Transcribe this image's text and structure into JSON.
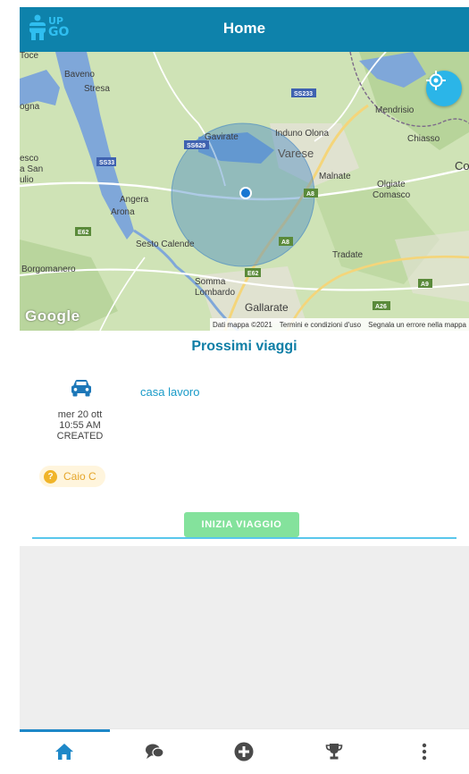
{
  "header": {
    "title": "Home",
    "logo_text_top": "UP",
    "logo_text_bottom": "GO"
  },
  "map": {
    "place_labels": [
      "Baveno",
      "Stresa",
      "Gavirate",
      "Induno Olona",
      "Mendrisio",
      "Chiasso",
      "Varese",
      "Malnate",
      "Olgiate Comasco",
      "Angera",
      "Arona",
      "Sesto Calende",
      "Tradate",
      "Borgomanero",
      "Somma Lombardo",
      "Gallarate",
      "Co",
      "ogna",
      "esco a San ulio",
      "Toce"
    ],
    "road_labels": [
      "SS233",
      "SS629",
      "SS33",
      "A8",
      "A8",
      "E62",
      "A26",
      "A9",
      "E62"
    ],
    "google_label": "Google",
    "attribution": [
      "Dati mappa ©2021",
      "Termini e condizioni d'uso",
      "Segnala un errore nella mappa"
    ],
    "colors": {
      "land": "#cfe3b6",
      "lake": "#7fa7d9",
      "radius": "#3d82c4",
      "urban": "#e6e2d8"
    }
  },
  "trips": {
    "section_title": "Prossimi viaggi",
    "items": [
      {
        "name": "casa lavoro",
        "date": "mer 20 ott",
        "time": "10:55 AM",
        "status": "CREATED",
        "user": "Caio C",
        "user_icon": "question-icon",
        "action_label": "INIZIA VIAGGIO"
      }
    ]
  },
  "nav": {
    "items": [
      {
        "icon": "home-icon",
        "active": true
      },
      {
        "icon": "chat-icon",
        "active": false
      },
      {
        "icon": "add-icon",
        "active": false
      },
      {
        "icon": "trophy-icon",
        "active": false
      },
      {
        "icon": "more-icon",
        "active": false
      }
    ],
    "colors": {
      "active": "#1e88c8",
      "inactive": "#4a4a4a"
    }
  }
}
